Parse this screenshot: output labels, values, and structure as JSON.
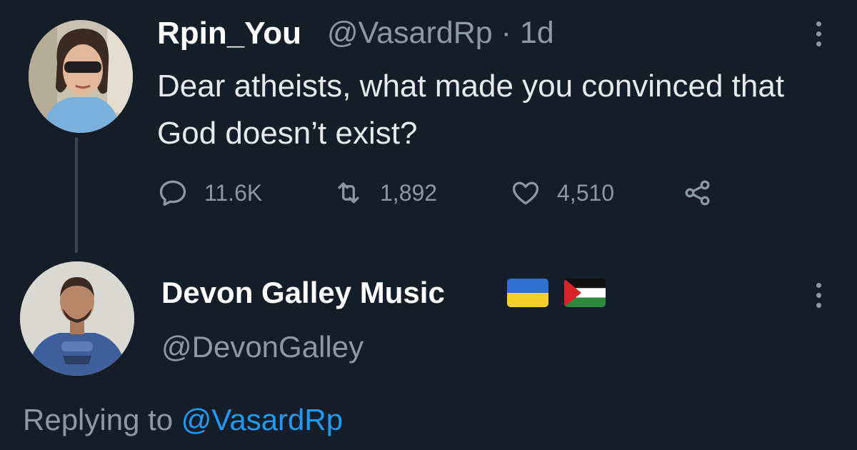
{
  "tweet": {
    "author_name": "Rpin_You",
    "handle_time": "@VasardRp · 1d",
    "text": "Dear atheists, what made you convinced that God doesn’t exist?",
    "stats": {
      "replies": "11.6K",
      "retweets": "1,892",
      "likes": "4,510"
    },
    "icons": {
      "reply": "reply-icon",
      "retweet": "retweet-icon",
      "like": "heart-icon",
      "share": "share-icon",
      "more": "more-icon"
    }
  },
  "reply": {
    "author_name": "Devon Galley Music",
    "handle": "@DevonGalley",
    "flags": [
      "ukraine-flag",
      "palestine-flag"
    ],
    "replying_prefix": "Replying to",
    "replying_to": "@VasardRp"
  },
  "colors": {
    "background": "#151d28",
    "text": "#e7e9ea",
    "muted": "#8b98a5",
    "link": "#1d9bf0"
  }
}
